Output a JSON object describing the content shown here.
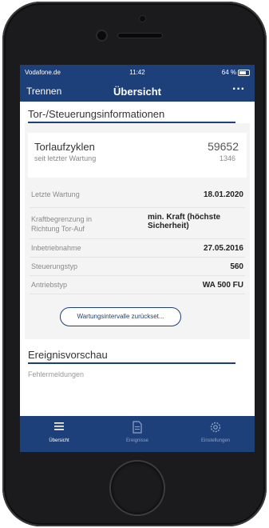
{
  "status_bar": {
    "carrier": "Vodafone.de",
    "time": "11:42",
    "battery": "64 %"
  },
  "nav": {
    "left": "Trennen",
    "title": "Übersicht",
    "more": "···"
  },
  "info_section": {
    "title": "Tor-/Steuerungsinformationen",
    "cycles": {
      "label": "Torlaufzyklen",
      "value": "59652",
      "sub_label": "seit letzter Wartung",
      "sub_value": "1346"
    },
    "rows": [
      {
        "label": "Letzte Wartung",
        "value": "18.01.2020"
      },
      {
        "label": "Kraftbegrenzung in Richtung Tor-Auf",
        "value": "min. Kraft (höchste Sicherheit)"
      },
      {
        "label": "Inbetriebnahme",
        "value": "27.05.2016"
      },
      {
        "label": "Steuerungstyp",
        "value": "560"
      },
      {
        "label": "Antriebstyp",
        "value": "WA 500 FU"
      }
    ],
    "reset_button": "Wartungsintervalle zurückset..."
  },
  "events_section": {
    "title": "Ereignisvorschau",
    "subtitle": "Fehlermeldungen"
  },
  "tab_bar": {
    "tabs": [
      {
        "label": "Übersicht",
        "icon": "list-icon",
        "active": true
      },
      {
        "label": "Ereignisse",
        "icon": "document-icon",
        "active": false
      },
      {
        "label": "Einstellungen",
        "icon": "gear-icon",
        "active": false
      }
    ]
  },
  "colors": {
    "brand_blue": "#1d3f7a"
  }
}
